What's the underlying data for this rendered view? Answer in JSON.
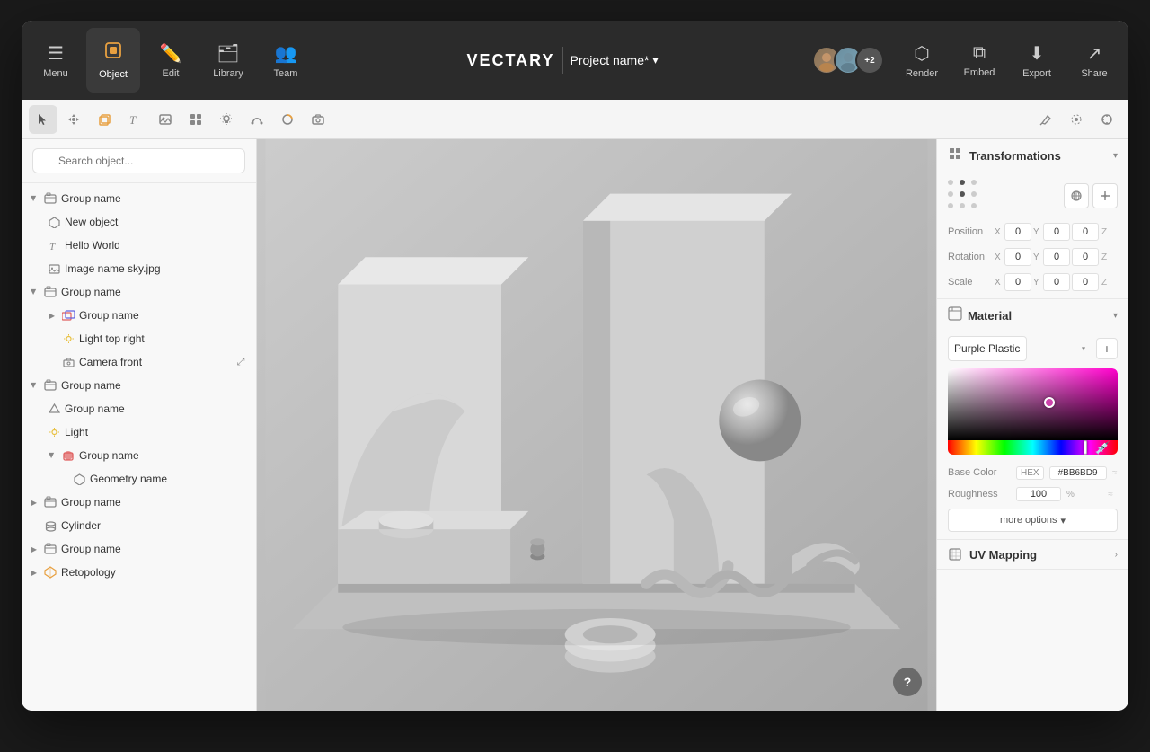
{
  "app": {
    "brand": "VECTARY",
    "window_bg": "#1a1a1a"
  },
  "header": {
    "menu_label": "Menu",
    "object_label": "Object",
    "edit_label": "Edit",
    "library_label": "Library",
    "team_label": "Team",
    "project_name": "Project name*",
    "render_label": "Render",
    "embed_label": "Embed",
    "export_label": "Export",
    "share_label": "Share",
    "avatar_count": "+2"
  },
  "toolbar": {
    "tools": [
      "cursor",
      "transform",
      "cube",
      "text",
      "image",
      "grid",
      "light",
      "curve",
      "mesh",
      "camera"
    ],
    "right_tools": [
      "pen",
      "circle_dot",
      "circle_outline"
    ]
  },
  "sidebar": {
    "search_placeholder": "Search object...",
    "tree": [
      {
        "id": "grp1",
        "label": "Group name",
        "type": "group",
        "level": 0,
        "collapsed": false,
        "has_actions": true
      },
      {
        "id": "newobj",
        "label": "New object",
        "type": "object",
        "level": 1
      },
      {
        "id": "hello",
        "label": "Hello World",
        "type": "text",
        "level": 1
      },
      {
        "id": "img",
        "label": "Image name sky.jpg",
        "type": "image",
        "level": 1
      },
      {
        "id": "grp2",
        "label": "Group name",
        "type": "group",
        "level": 0,
        "collapsed": false
      },
      {
        "id": "grp2a",
        "label": "Group name",
        "type": "multigroup",
        "level": 1
      },
      {
        "id": "light1",
        "label": "Light top right",
        "type": "light",
        "level": 2
      },
      {
        "id": "cam1",
        "label": "Camera front",
        "type": "camera",
        "level": 2
      },
      {
        "id": "grp3",
        "label": "Group name",
        "type": "group",
        "level": 0,
        "collapsed": false
      },
      {
        "id": "grp3a",
        "label": "Group name",
        "type": "object",
        "level": 1
      },
      {
        "id": "light2",
        "label": "Light",
        "type": "light",
        "level": 1
      },
      {
        "id": "grp3b",
        "label": "Group name",
        "type": "group_colored",
        "level": 1,
        "collapsed": false
      },
      {
        "id": "geo1",
        "label": "Geometry name",
        "type": "geometry",
        "level": 2
      },
      {
        "id": "grp4",
        "label": "Group name",
        "type": "group",
        "level": 0,
        "collapsed": true
      },
      {
        "id": "cyl",
        "label": "Cylinder",
        "type": "cylinder",
        "level": 0
      },
      {
        "id": "grp5",
        "label": "Group name",
        "type": "group",
        "level": 0,
        "collapsed": true
      },
      {
        "id": "retopo",
        "label": "Retopology",
        "type": "retopo",
        "level": 0,
        "collapsed": true
      }
    ]
  },
  "right_panel": {
    "transformations": {
      "title": "Transformations",
      "position": {
        "label": "Position",
        "x": "0",
        "y": "0",
        "z": "0"
      },
      "rotation": {
        "label": "Rotation",
        "x": "0",
        "y": "0",
        "z": "0"
      },
      "scale": {
        "label": "Scale",
        "x": "0",
        "y": "0",
        "z": "0"
      }
    },
    "material": {
      "title": "Material",
      "selected": "Purple Plastic",
      "base_color_label": "Base Color",
      "base_color_mode": "HEX",
      "base_color_value": "#BB6BD9",
      "roughness_label": "Roughness",
      "roughness_value": "100",
      "roughness_unit": "%",
      "more_options_label": "more options"
    },
    "uv_mapping": {
      "title": "UV Mapping"
    }
  },
  "help_btn": "?"
}
